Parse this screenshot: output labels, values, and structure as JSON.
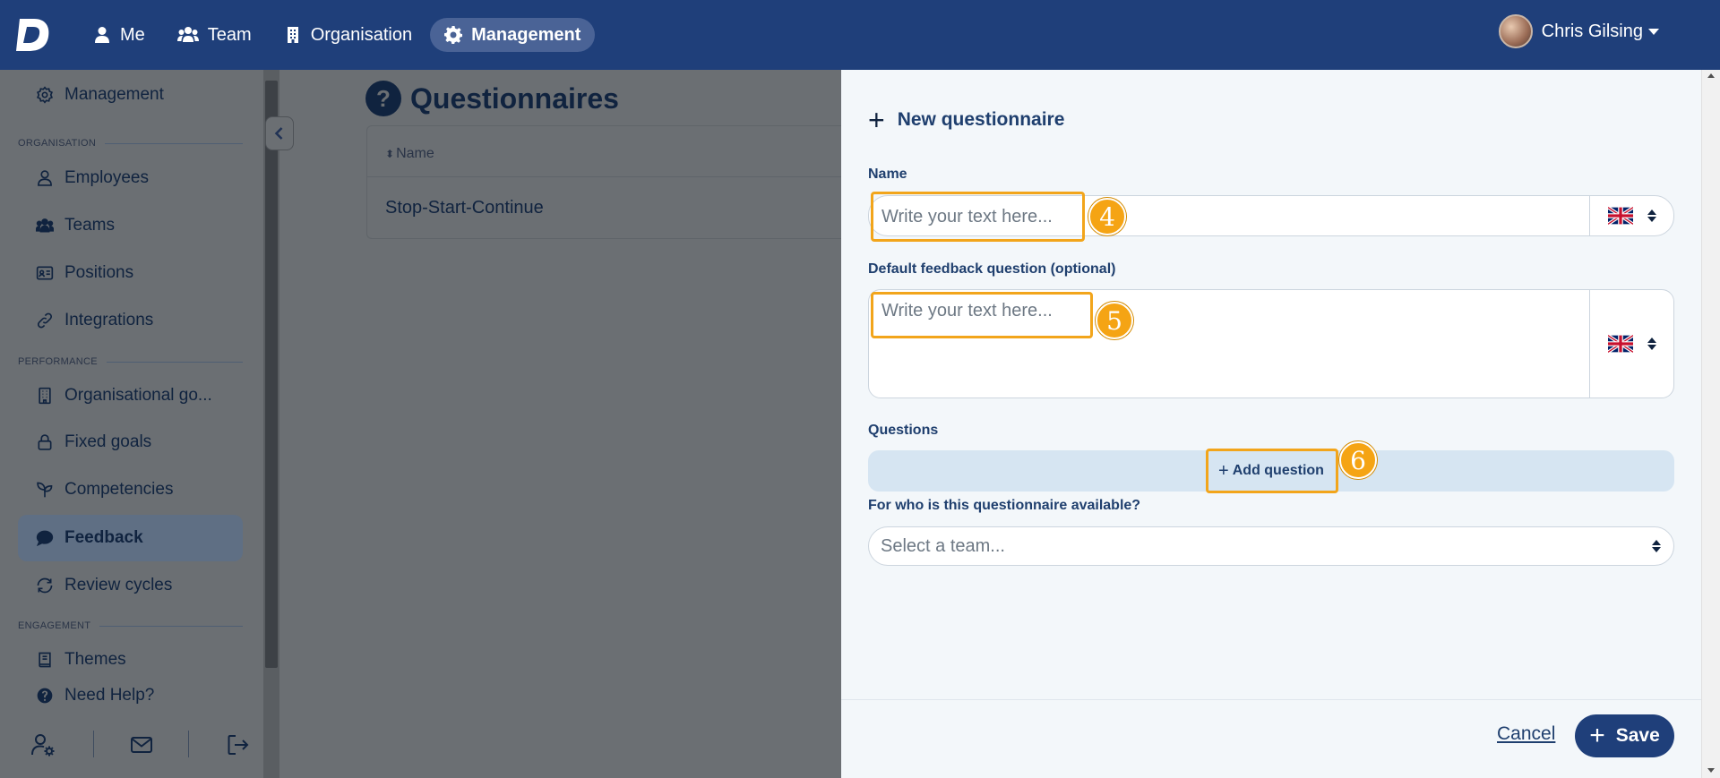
{
  "nav": {
    "items": [
      {
        "label": "Me",
        "icon": "person-icon"
      },
      {
        "label": "Team",
        "icon": "people-icon"
      },
      {
        "label": "Organisation",
        "icon": "building-icon"
      },
      {
        "label": "Management",
        "icon": "gear-icon"
      }
    ],
    "active": "Management",
    "user_name": "Chris Gilsing"
  },
  "sidebar": {
    "management": "Management",
    "sections": {
      "organisation": "ORGANISATION",
      "performance": "PERFORMANCE",
      "engagement": "ENGAGEMENT"
    },
    "items": {
      "employees": "Employees",
      "teams": "Teams",
      "positions": "Positions",
      "integrations": "Integrations",
      "org_goals": "Organisational go...",
      "fixed_goals": "Fixed goals",
      "competencies": "Competencies",
      "feedback": "Feedback",
      "review_cycles": "Review cycles",
      "themes": "Themes",
      "need_help": "Need Help?"
    }
  },
  "page": {
    "title": "Questionnaires",
    "table_header_name": "Name",
    "rows": [
      "Stop-Start-Continue"
    ]
  },
  "drawer": {
    "title": "New questionnaire",
    "name_label": "Name",
    "name_placeholder": "Write your text here...",
    "default_q_label": "Default feedback question (optional)",
    "default_q_placeholder": "Write your text here...",
    "questions_label": "Questions",
    "add_question": "Add question",
    "available_label": "For who is this questionnaire available?",
    "team_placeholder": "Select a team...",
    "cancel": "Cancel",
    "save": "Save"
  },
  "steps": {
    "name": "4",
    "default_question": "5",
    "add_question": "6"
  },
  "colors": {
    "brand": "#1f3f7a",
    "highlight": "#f2a51b",
    "step_badge": "#f5a414"
  }
}
